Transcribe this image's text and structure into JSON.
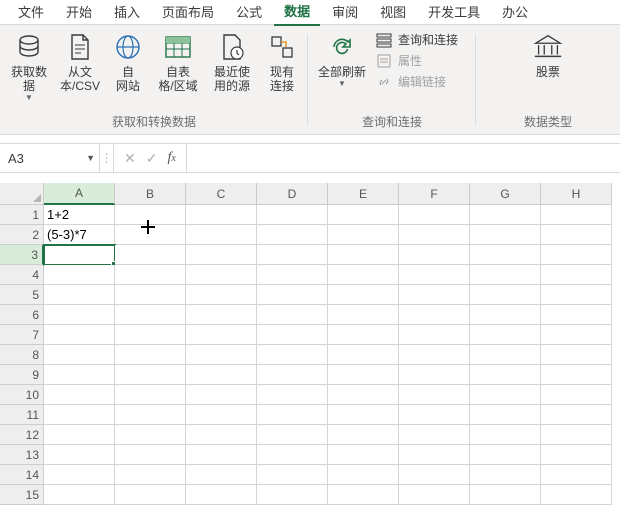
{
  "tabs": {
    "file": "文件",
    "items": [
      "开始",
      "插入",
      "页面布局",
      "公式",
      "数据",
      "审阅",
      "视图",
      "开发工具",
      "办公"
    ],
    "active_index": 4
  },
  "ribbon": {
    "group1": {
      "label": "获取和转换数据",
      "btns": {
        "get_data": "获取数\n据",
        "from_csv": "从文\n本/CSV",
        "from_web": "自\n网站",
        "from_table": "自表\n格/区域",
        "recent": "最近使\n用的源",
        "existing": "现有\n连接"
      }
    },
    "group2": {
      "label": "查询和连接",
      "btns": {
        "refresh_all": "全部刷新"
      },
      "mini": {
        "queries": "查询和连接",
        "props": "属性",
        "edit_links": "编辑链接"
      }
    },
    "group3": {
      "label": "数据类型",
      "btns": {
        "stocks": "股票"
      }
    }
  },
  "formula_bar": {
    "name_box": "A3",
    "formula": ""
  },
  "columns": [
    "A",
    "B",
    "C",
    "D",
    "E",
    "F",
    "G",
    "H"
  ],
  "active_col_index": 0,
  "active_row_index": 2,
  "rows": 15,
  "cells": {
    "A1": "1+2",
    "A2": "(5-3)*7"
  },
  "selected_cell": "A3"
}
